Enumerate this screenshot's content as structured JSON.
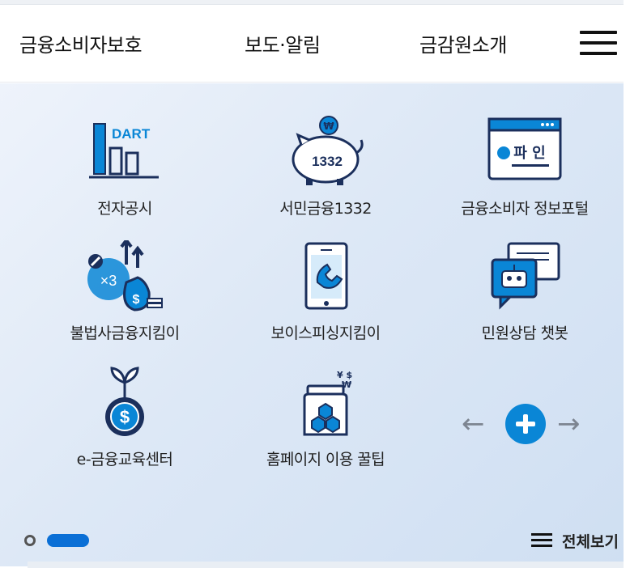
{
  "nav": {
    "items": [
      "금융소비자보호",
      "보도·알림",
      "금감원소개"
    ],
    "menu_icon": "hamburger-menu-icon"
  },
  "tiles": [
    {
      "label": "전자공시",
      "icon": "dart-chart-icon",
      "icon_text": "DART"
    },
    {
      "label": "서민금융1332",
      "icon": "piggy-bank-icon",
      "icon_text": "1332"
    },
    {
      "label": "금융소비자 정보포털",
      "icon": "fine-portal-icon",
      "icon_text": "파 인"
    },
    {
      "label": "불법사금융지킴이",
      "icon": "money-bag-icon",
      "icon_text": "×3"
    },
    {
      "label": "보이스피싱지킴이",
      "icon": "phone-call-icon"
    },
    {
      "label": "민원상담 챗봇",
      "icon": "chatbot-icon"
    },
    {
      "label": "e-금융교육센터",
      "icon": "coin-sprout-icon"
    },
    {
      "label": "홈페이지 이용 꿀팁",
      "icon": "honey-jar-icon"
    }
  ],
  "controls": {
    "prev_arrow": "←",
    "next_arrow": "→",
    "more_icon": "plus-circle-icon"
  },
  "footer": {
    "view_all": "전체보기"
  },
  "colors": {
    "accent": "#0a86d6",
    "icon_navy": "#1b2f5c",
    "pager_active": "#0a6fd6"
  }
}
